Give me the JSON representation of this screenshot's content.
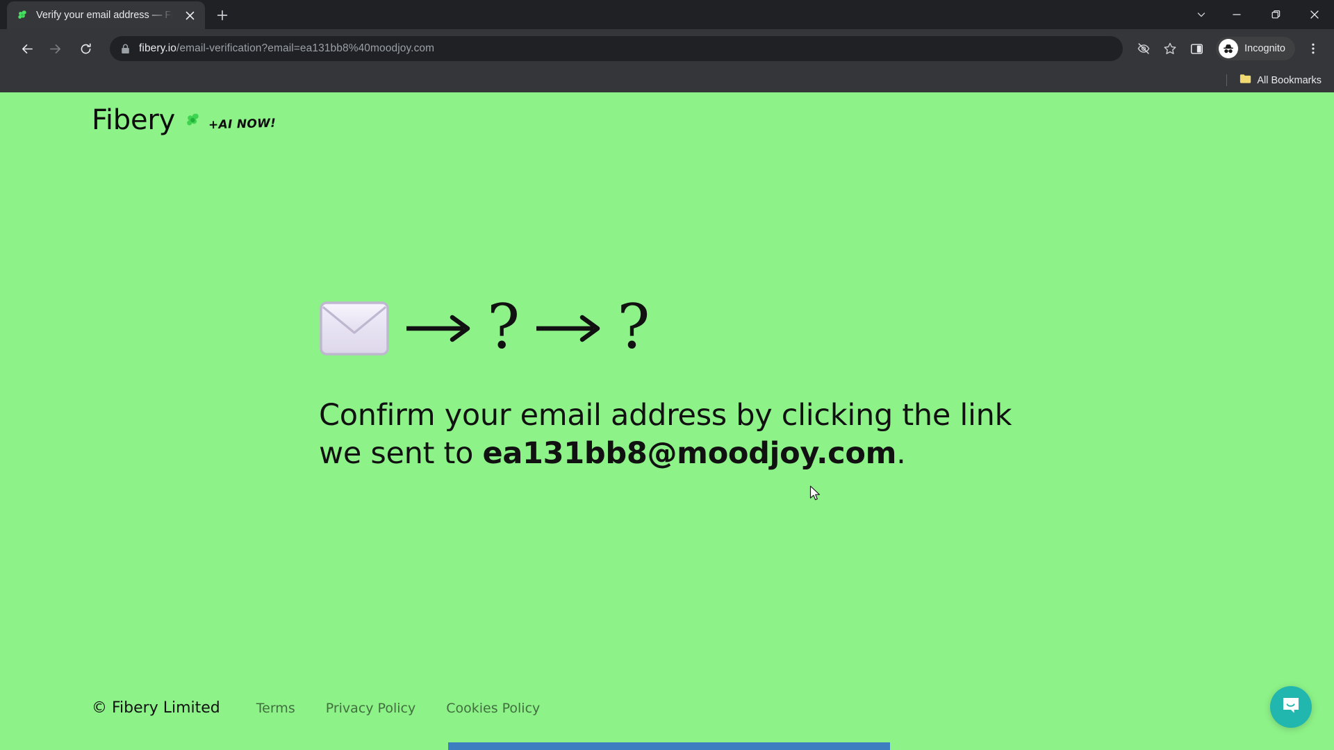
{
  "browser": {
    "tab": {
      "title": "Verify your email address — Fib",
      "favicon_icon": "fibery-leaf-favicon",
      "close_icon": "close-icon"
    },
    "new_tab_icon": "plus-icon",
    "window_controls": {
      "tab_search_icon": "chevron-down-icon",
      "minimize_icon": "minimize-icon",
      "maximize_icon": "maximize-restore-icon",
      "close_icon": "window-close-icon"
    },
    "toolbar": {
      "back_icon": "back-arrow-icon",
      "forward_icon": "forward-arrow-icon",
      "reload_icon": "reload-icon",
      "lock_icon": "lock-icon",
      "url_host": "fibery.io",
      "url_path": "/email-verification?email=ea131bb8%40moodjoy.com",
      "tracking_protection_icon": "eye-slash-icon",
      "bookmark_icon": "star-icon",
      "side_panel_icon": "side-panel-icon",
      "profile_icon": "incognito-icon",
      "profile_label": "Incognito",
      "menu_icon": "kebab-menu-icon"
    },
    "bookmarks_bar": {
      "folder_icon": "folder-icon",
      "all_bookmarks_label": "All Bookmarks"
    }
  },
  "page": {
    "background_color": "#8df288",
    "header": {
      "wordmark": "Fibery",
      "mark_icon": "fibery-clover-logo",
      "tagline": "+AI NOW!"
    },
    "hero": {
      "graphic": {
        "envelope_icon": "envelope-icon",
        "arrow_icon": "right-arrow-icon",
        "question_mark": "?"
      },
      "heading_prefix": "Confirm your email address by clicking the link we sent to ",
      "heading_email": "ea131bb8@moodjoy.com",
      "heading_suffix": "."
    },
    "footer": {
      "copyright": "© Fibery Limited",
      "links": [
        {
          "label": "Terms"
        },
        {
          "label": "Privacy Policy"
        },
        {
          "label": "Cookies Policy"
        }
      ]
    },
    "chat_launcher": {
      "icon": "chat-bubble-icon",
      "color": "#21b6ae"
    },
    "scrollbar": {
      "orientation": "horizontal",
      "thumb_color": "#3c7ebf"
    },
    "cursor_icon": "mouse-pointer"
  }
}
